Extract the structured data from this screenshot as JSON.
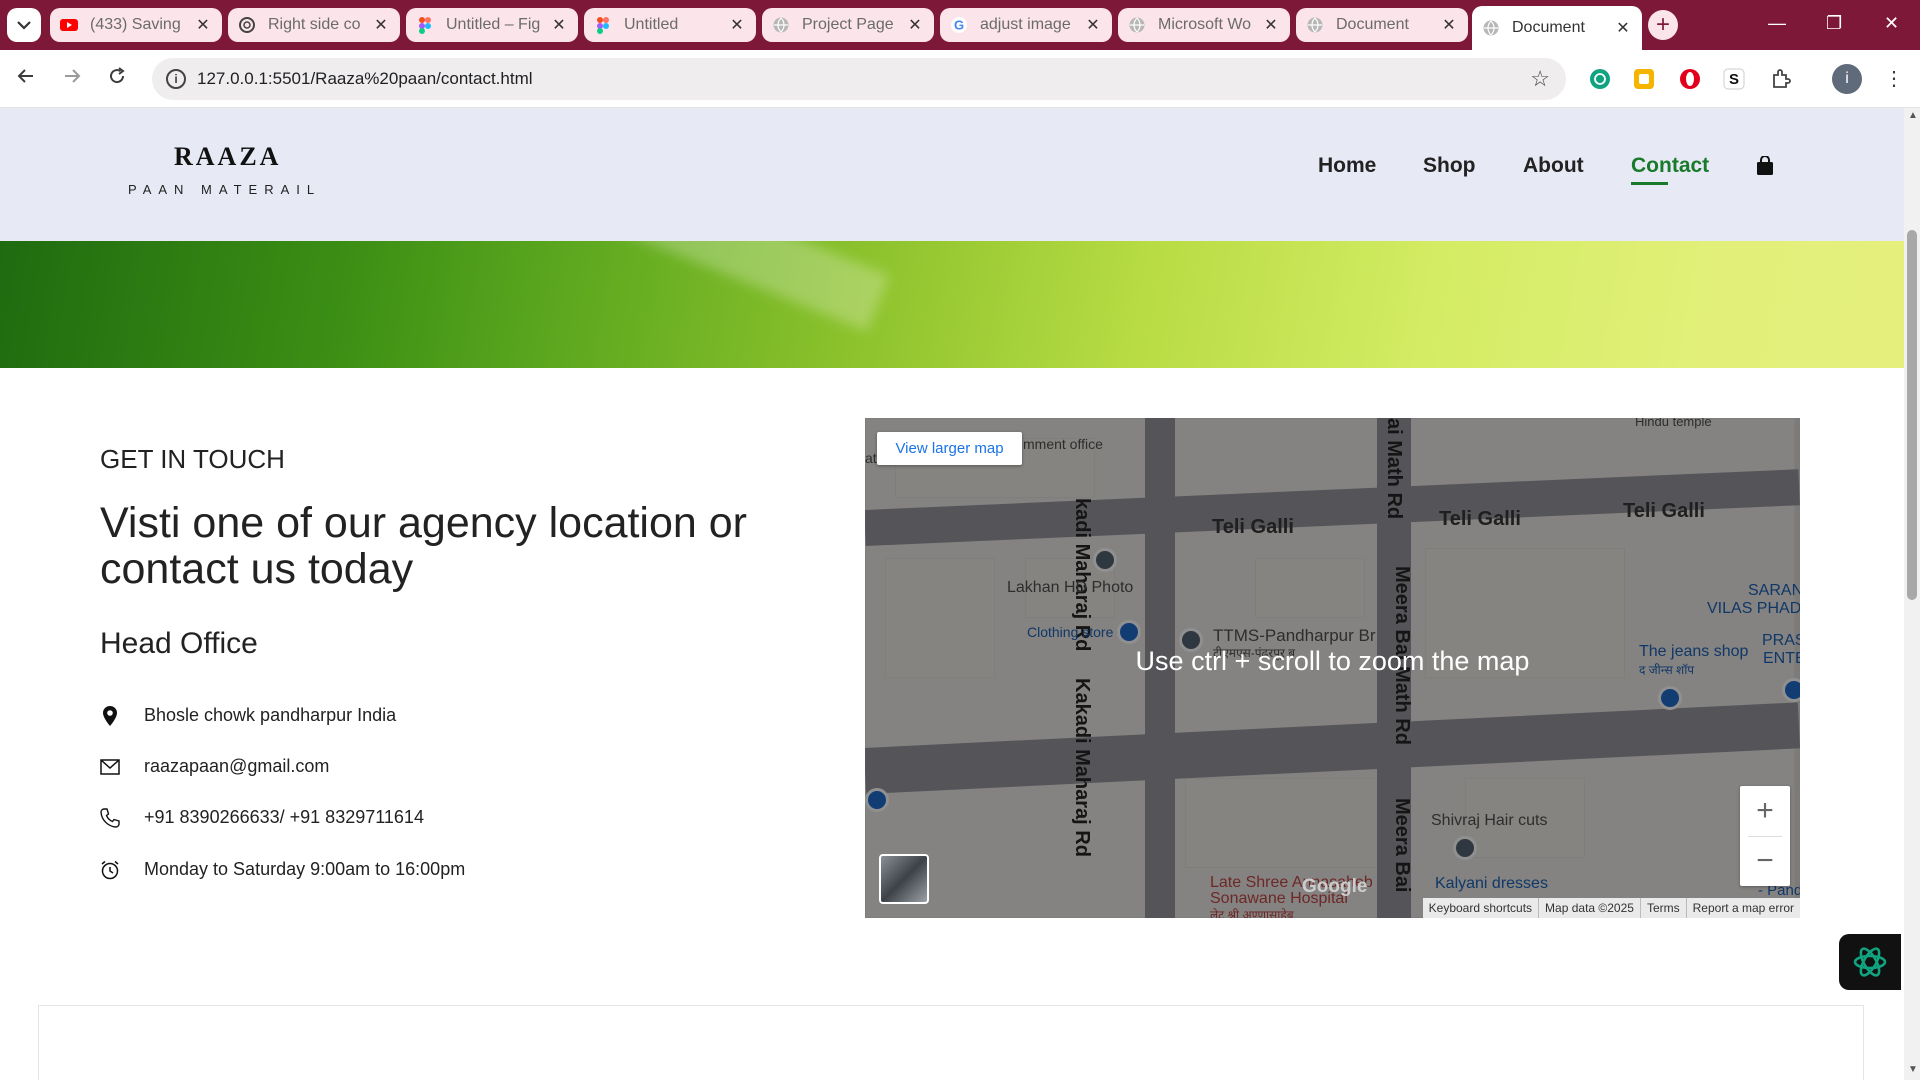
{
  "browser": {
    "tabs": [
      {
        "label": "(433) Saving",
        "favicon": "youtube-icon",
        "color": "#ff0000"
      },
      {
        "label": "Right side co",
        "favicon": "openai-icon",
        "color": "#444444"
      },
      {
        "label": "Untitled – Fig",
        "favicon": "figma-icon",
        "color": "#a259ff"
      },
      {
        "label": "Untitled",
        "favicon": "figma-icon",
        "color": "#a259ff"
      },
      {
        "label": "Project Page",
        "favicon": "globe-icon",
        "color": "#9a9a9a"
      },
      {
        "label": "adjust image",
        "favicon": "google-icon",
        "color": "#4285f4"
      },
      {
        "label": "Microsoft Wo",
        "favicon": "globe-icon",
        "color": "#9a9a9a"
      },
      {
        "label": "Document",
        "favicon": "globe-icon",
        "color": "#9a9a9a"
      },
      {
        "label": "Document",
        "favicon": "globe-icon",
        "color": "#9a9a9a"
      }
    ],
    "url": "127.0.0.1:5501/Raaza%20paan/contact.html",
    "profile_initial": "i"
  },
  "site": {
    "logo_main": "RAAZA",
    "logo_sub": "PAAN MATERAIL",
    "nav": [
      "Home",
      "Shop",
      "About",
      "Contact"
    ],
    "active_nav": "Contact",
    "accent": "#1a7a2b"
  },
  "contact": {
    "eyebrow": "GET IN TOUCH",
    "headline": "Visti one of our agency location or contact us today",
    "office_title": "Head Office",
    "address": "Bhosle chowk pandharpur India",
    "email": "raazapaan@gmail.com",
    "phone": "+91 8390266633/ +91 8329711614",
    "hours": "Monday to Saturday 9:00am to 16:00pm"
  },
  "map": {
    "view_larger": "View larger map",
    "zoom_hint": "Use ctrl + scroll to zoom the map",
    "labels": {
      "government_office": "mment office",
      "teli_galli_1": "Teli Galli",
      "teli_galli_2": "Teli Galli",
      "teli_galli_3": "Teli Galli",
      "kakadi_1": "kadi Maharaj Rd",
      "kakadi_2": "Kakadi Maharaj Rd",
      "meera_1": "ai Math Rd",
      "meera_2": "Meera Bai Math Rd",
      "meera_3": "Meera Bai",
      "lakhan": "Lakhan HD Photo",
      "clothing": "Clothing store",
      "ttms": "TTMS-Pandharpur Br",
      "ttms_marathi": "टीएमएस-पंढरपूर ब",
      "jeans": "The jeans shop",
      "jeans_marathi": "द जीन्स शॉप",
      "saran": "SARAN",
      "vilas": "VILAS PHAD",
      "pras": "PRAS",
      "ente": "ENTE",
      "shivraj": "Shivraj Hair cuts",
      "kalyani": "Kalyani dresses",
      "hospital_1": "Late Shree Annasaheb",
      "hospital_2": "Sonawane Hospital",
      "hospital_marathi": "लेट श्री अण्णासाहेब",
      "hindu_temple": "Hindu temple",
      "at": "at",
      "pand": "- Pand",
      "a": "a"
    },
    "attribution": [
      "Keyboard shortcuts",
      "Map data ©2025",
      "Terms",
      "Report a map error"
    ],
    "google_text": "Google"
  }
}
